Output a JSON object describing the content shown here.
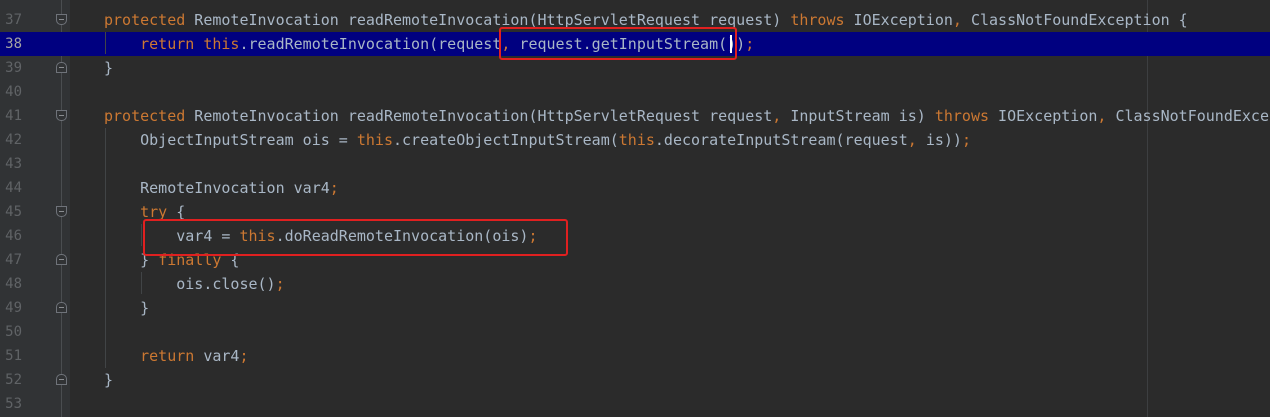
{
  "editor": {
    "lines": [
      {
        "num": "37",
        "pre": "",
        "tokens": [
          {
            "t": "protected",
            "kw": true
          },
          {
            "t": " RemoteInvocation readRemoteInvocation(HttpServletRequest request) "
          },
          {
            "t": "throws",
            "kw": true
          },
          {
            "t": " IOException"
          },
          {
            "t": ",",
            "kw": true
          },
          {
            "t": " ClassNotFoundException {"
          }
        ]
      },
      {
        "num": "38",
        "pre": "    ",
        "tokens": [
          {
            "t": "return this",
            "kw": true
          },
          {
            "t": ".readRemoteInvocation(request"
          },
          {
            "t": ",",
            "kw": true
          },
          {
            "t": " request.getInputStream())"
          },
          {
            "t": ";",
            "kw": true
          }
        ]
      },
      {
        "num": "39",
        "pre": "",
        "tokens": [
          {
            "t": "}"
          }
        ]
      },
      {
        "num": "40",
        "pre": "",
        "tokens": []
      },
      {
        "num": "41",
        "pre": "",
        "tokens": [
          {
            "t": "protected",
            "kw": true
          },
          {
            "t": " RemoteInvocation readRemoteInvocation(HttpServletRequest request"
          },
          {
            "t": ",",
            "kw": true
          },
          {
            "t": " InputStream is) "
          },
          {
            "t": "throws",
            "kw": true
          },
          {
            "t": " IOException"
          },
          {
            "t": ",",
            "kw": true
          },
          {
            "t": " ClassNotFoundExcep"
          }
        ]
      },
      {
        "num": "42",
        "pre": "    ",
        "tokens": [
          {
            "t": "ObjectInputStream ois = "
          },
          {
            "t": "this",
            "kw": true
          },
          {
            "t": ".createObjectInputStream("
          },
          {
            "t": "this",
            "kw": true
          },
          {
            "t": ".decorateInputStream(request"
          },
          {
            "t": ",",
            "kw": true
          },
          {
            "t": " is))"
          },
          {
            "t": ";",
            "kw": true
          }
        ]
      },
      {
        "num": "43",
        "pre": "",
        "tokens": []
      },
      {
        "num": "44",
        "pre": "    ",
        "tokens": [
          {
            "t": "RemoteInvocation var4"
          },
          {
            "t": ";",
            "kw": true
          }
        ]
      },
      {
        "num": "45",
        "pre": "    ",
        "tokens": [
          {
            "t": "try",
            "kw": true
          },
          {
            "t": " {"
          }
        ]
      },
      {
        "num": "46",
        "pre": "        ",
        "tokens": [
          {
            "t": "var4 = "
          },
          {
            "t": "this",
            "kw": true
          },
          {
            "t": ".doReadRemoteInvocation(ois)"
          },
          {
            "t": ";",
            "kw": true
          }
        ]
      },
      {
        "num": "47",
        "pre": "    ",
        "tokens": [
          {
            "t": "} "
          },
          {
            "t": "finally",
            "kw": true
          },
          {
            "t": " {"
          }
        ]
      },
      {
        "num": "48",
        "pre": "        ",
        "tokens": [
          {
            "t": "ois.close()"
          },
          {
            "t": ";",
            "kw": true
          }
        ]
      },
      {
        "num": "49",
        "pre": "    ",
        "tokens": [
          {
            "t": "}"
          }
        ]
      },
      {
        "num": "50",
        "pre": "",
        "tokens": []
      },
      {
        "num": "51",
        "pre": "    ",
        "tokens": [
          {
            "t": "return",
            "kw": true
          },
          {
            "t": " var4"
          },
          {
            "t": ";",
            "kw": true
          }
        ]
      },
      {
        "num": "52",
        "pre": "",
        "tokens": [
          {
            "t": "}"
          }
        ]
      },
      {
        "num": "53",
        "pre": "",
        "tokens": []
      }
    ],
    "current_line": "38",
    "colors": {
      "background": "#2b2b2b",
      "keyword": "#cc7832",
      "text": "#a9b7c6",
      "current_line": "#000080",
      "annotation_box": "#e02020"
    }
  }
}
